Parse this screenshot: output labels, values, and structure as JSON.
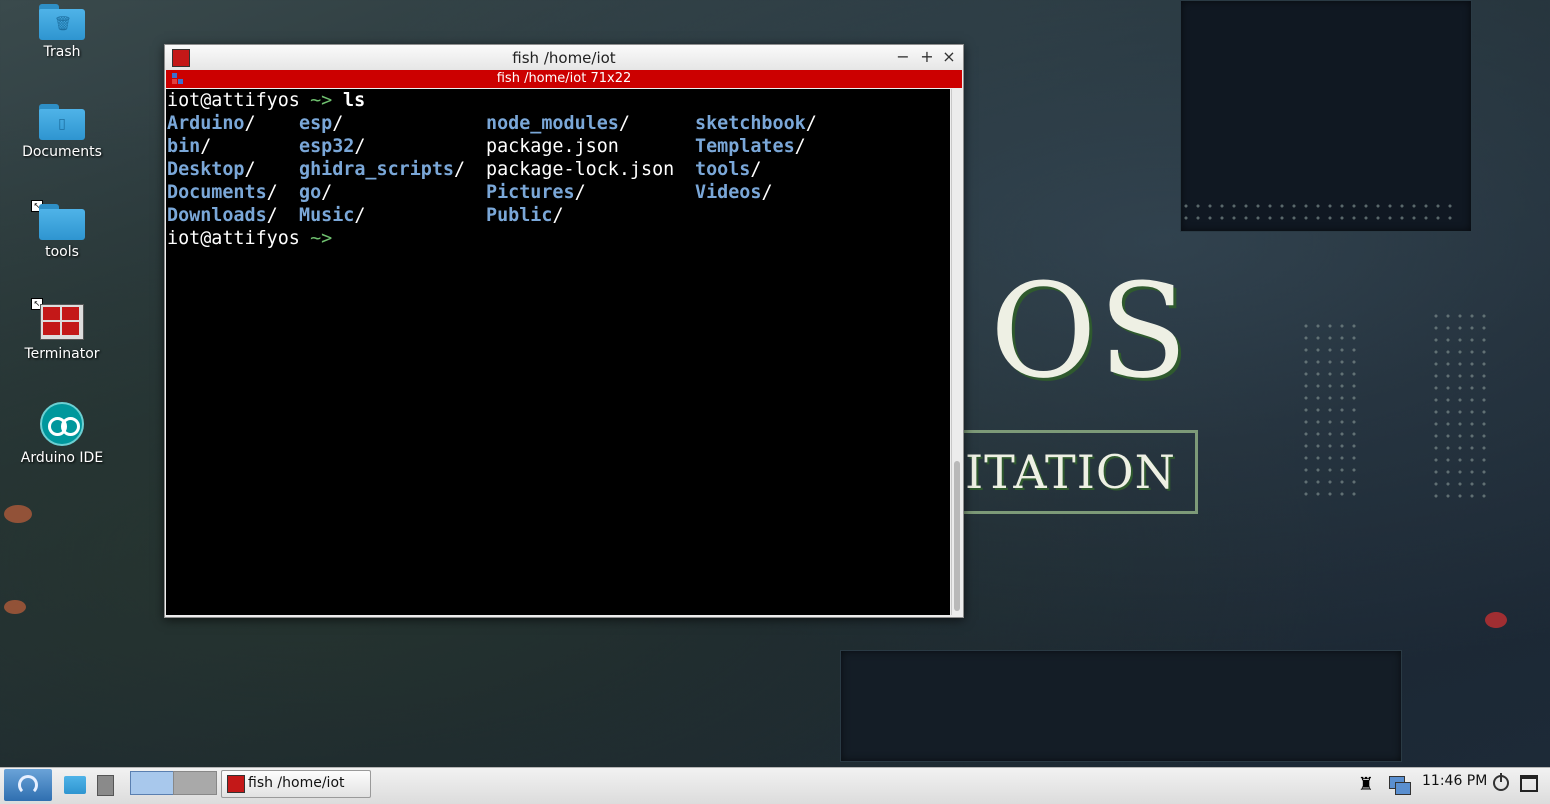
{
  "desktop": {
    "icons": [
      {
        "name": "trash",
        "label": "Trash"
      },
      {
        "name": "documents",
        "label": "Documents"
      },
      {
        "name": "tools",
        "label": "tools"
      },
      {
        "name": "terminator",
        "label": "Terminator"
      },
      {
        "name": "arduino-ide",
        "label": "Arduino IDE"
      }
    ],
    "wallpaper": {
      "logo_text": "OS",
      "tag_text": "ITATION"
    }
  },
  "window": {
    "title": "fish  /home/iot",
    "tab_title": "fish  /home/iot 71x22",
    "controls": {
      "minimize": "−",
      "maximize": "+",
      "close": "×"
    }
  },
  "terminal": {
    "prompt_user": "iot@attifyos",
    "prompt_path": " ~> ",
    "command": "ls",
    "listing": [
      [
        {
          "t": "Arduino",
          "s": "/",
          "d": true
        },
        {
          "t": "esp",
          "s": "/",
          "d": true
        },
        {
          "t": "node_modules",
          "s": "/",
          "d": true
        },
        {
          "t": "sketchbook",
          "s": "/",
          "d": true
        }
      ],
      [
        {
          "t": "bin",
          "s": "/",
          "d": true
        },
        {
          "t": "esp32",
          "s": "/",
          "d": true
        },
        {
          "t": "package.json",
          "s": "",
          "d": false
        },
        {
          "t": "Templates",
          "s": "/",
          "d": true
        }
      ],
      [
        {
          "t": "Desktop",
          "s": "/",
          "d": true
        },
        {
          "t": "ghidra_scripts",
          "s": "/",
          "d": true
        },
        {
          "t": "package-lock.json",
          "s": "",
          "d": false
        },
        {
          "t": "tools",
          "s": "/",
          "d": true
        }
      ],
      [
        {
          "t": "Documents",
          "s": "/",
          "d": true
        },
        {
          "t": "go",
          "s": "/",
          "d": true
        },
        {
          "t": "Pictures",
          "s": "/",
          "d": true
        },
        {
          "t": "Videos",
          "s": "/",
          "d": true
        }
      ],
      [
        {
          "t": "Downloads",
          "s": "/",
          "d": true
        },
        {
          "t": "Music",
          "s": "/",
          "d": true
        },
        {
          "t": "Public",
          "s": "/",
          "d": true
        }
      ]
    ],
    "colors": {
      "dir": "#7aa7d8",
      "text": "#ffffff",
      "bg": "#000000",
      "accent": "#cc0000"
    }
  },
  "taskbar": {
    "task_label": "fish /home/iot",
    "clock": "11:46 PM"
  }
}
